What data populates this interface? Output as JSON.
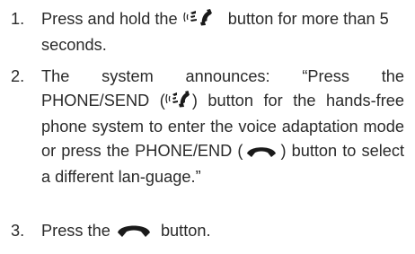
{
  "steps": [
    {
      "number": "1.",
      "text_before": "Press and hold the ",
      "text_after": " button for more than 5 seconds."
    },
    {
      "number": "2.",
      "part1": "The system announces: “Press the PHONE/SEND (",
      "part2": ") button for the hands-free phone system to enter the voice adaptation mode or press the PHONE/END (",
      "part3": ") button to select a different lan-guage.”"
    },
    {
      "number": "3.",
      "text_before": "Press the ",
      "text_after": " button."
    }
  ],
  "icons": {
    "phone_send": "phone-send-voice-icon",
    "phone_end": "phone-end-icon"
  },
  "colors": {
    "text": "#2a2a2a",
    "icon": "#1a1a1a"
  }
}
